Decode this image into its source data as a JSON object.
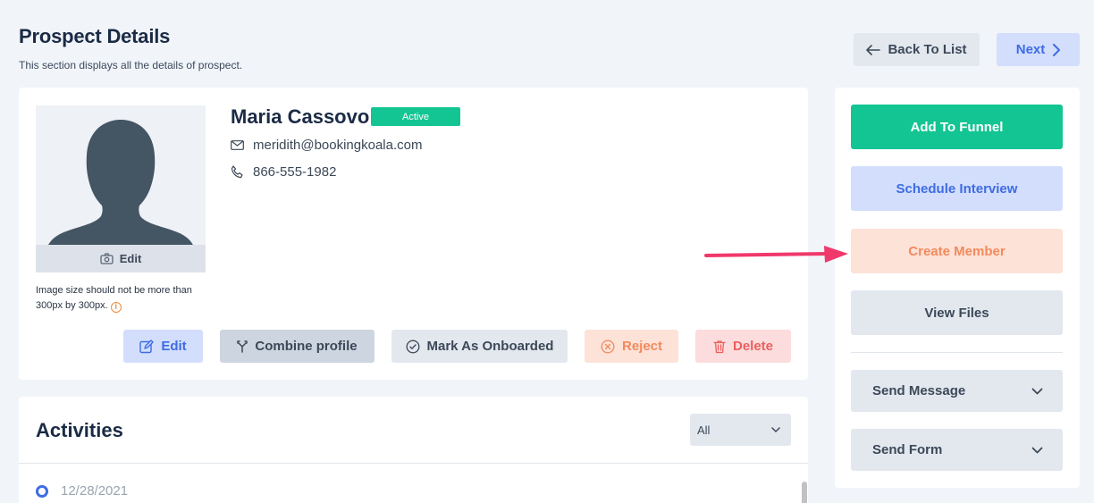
{
  "header": {
    "title": "Prospect Details",
    "subtitle": "This section displays all the details of prospect.",
    "back_label": "Back To List",
    "next_label": "Next"
  },
  "profile": {
    "avatar_edit_label": "Edit",
    "image_note": "Image size should not be more than 300px by 300px.",
    "name": "Maria Cassovo",
    "status": "Active",
    "email": "meridith@bookingkoala.com",
    "phone": "866-555-1982",
    "actions": {
      "edit": "Edit",
      "combine": "Combine profile",
      "onboard": "Mark As Onboarded",
      "reject": "Reject",
      "delete": "Delete"
    }
  },
  "activities": {
    "title": "Activities",
    "filter_value": "All",
    "items": [
      {
        "date": "12/28/2021"
      }
    ]
  },
  "sidebar": {
    "add_to_funnel": "Add To Funnel",
    "schedule_interview": "Schedule Interview",
    "create_member": "Create Member",
    "view_files": "View Files",
    "send_message": "Send Message",
    "send_form": "Send Form"
  },
  "colors": {
    "primary_green": "#13c592",
    "primary_blue": "#3f6ce3",
    "accent_orange": "#f28a5c",
    "danger_red": "#ec5f5f",
    "annotation_arrow": "#f0386b"
  }
}
